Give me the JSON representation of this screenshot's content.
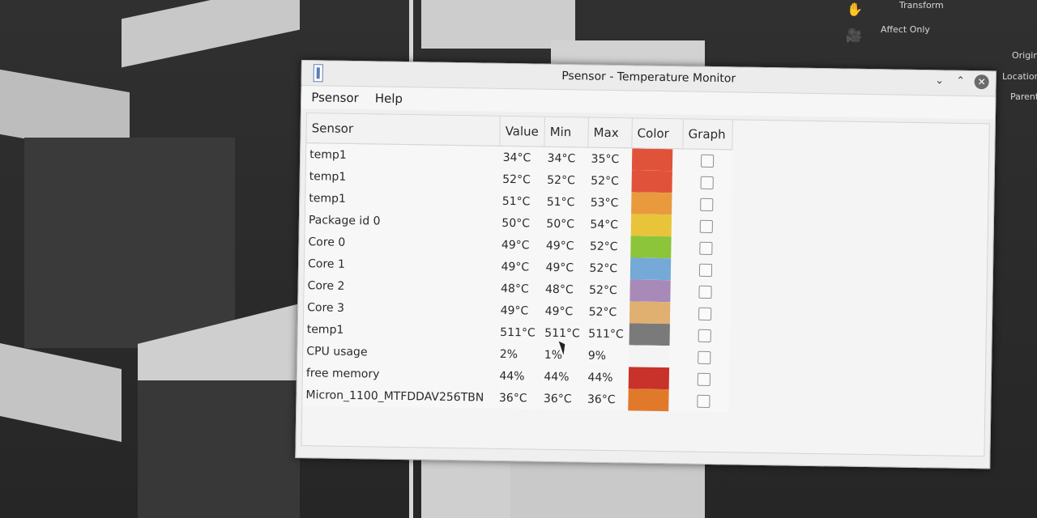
{
  "window": {
    "title": "Psensor - Temperature Monitor"
  },
  "menu": [
    "Psensor",
    "Help"
  ],
  "table": {
    "headers": {
      "sensor": "Sensor",
      "value": "Value",
      "min": "Min",
      "max": "Max",
      "color": "Color",
      "graph": "Graph"
    },
    "rows": [
      {
        "sensor": "temp1",
        "value": "34°C",
        "min": "34°C",
        "max": "35°C",
        "color": "#e0533a"
      },
      {
        "sensor": "temp1",
        "value": "52°C",
        "min": "52°C",
        "max": "52°C",
        "color": "#e0533a"
      },
      {
        "sensor": "temp1",
        "value": "51°C",
        "min": "51°C",
        "max": "53°C",
        "color": "#e89a3c"
      },
      {
        "sensor": "Package id 0",
        "value": "50°C",
        "min": "50°C",
        "max": "54°C",
        "color": "#e8c43a"
      },
      {
        "sensor": "Core 0",
        "value": "49°C",
        "min": "49°C",
        "max": "52°C",
        "color": "#8cc43a"
      },
      {
        "sensor": "Core 1",
        "value": "49°C",
        "min": "49°C",
        "max": "52°C",
        "color": "#74a9d8"
      },
      {
        "sensor": "Core 2",
        "value": "48°C",
        "min": "48°C",
        "max": "52°C",
        "color": "#a88ab8"
      },
      {
        "sensor": "Core 3",
        "value": "49°C",
        "min": "49°C",
        "max": "52°C",
        "color": "#e0b070"
      },
      {
        "sensor": "temp1",
        "value": "511°C",
        "min": "511°C",
        "max": "511°C",
        "color": "#7a7a7a"
      },
      {
        "sensor": "CPU usage",
        "value": "2%",
        "min": "1%",
        "max": "9%",
        "color": "#f4f4f4"
      },
      {
        "sensor": "free memory",
        "value": "44%",
        "min": "44%",
        "max": "44%",
        "color": "#c8322a"
      },
      {
        "sensor": "Micron_1100_MTFDDAV256TBN",
        "value": "36°C",
        "min": "36°C",
        "max": "36°C",
        "color": "#e07a2a"
      }
    ]
  },
  "background_panel": {
    "items": [
      "Transform",
      "Affect Only",
      "Origin",
      "Location",
      "Parents"
    ]
  }
}
